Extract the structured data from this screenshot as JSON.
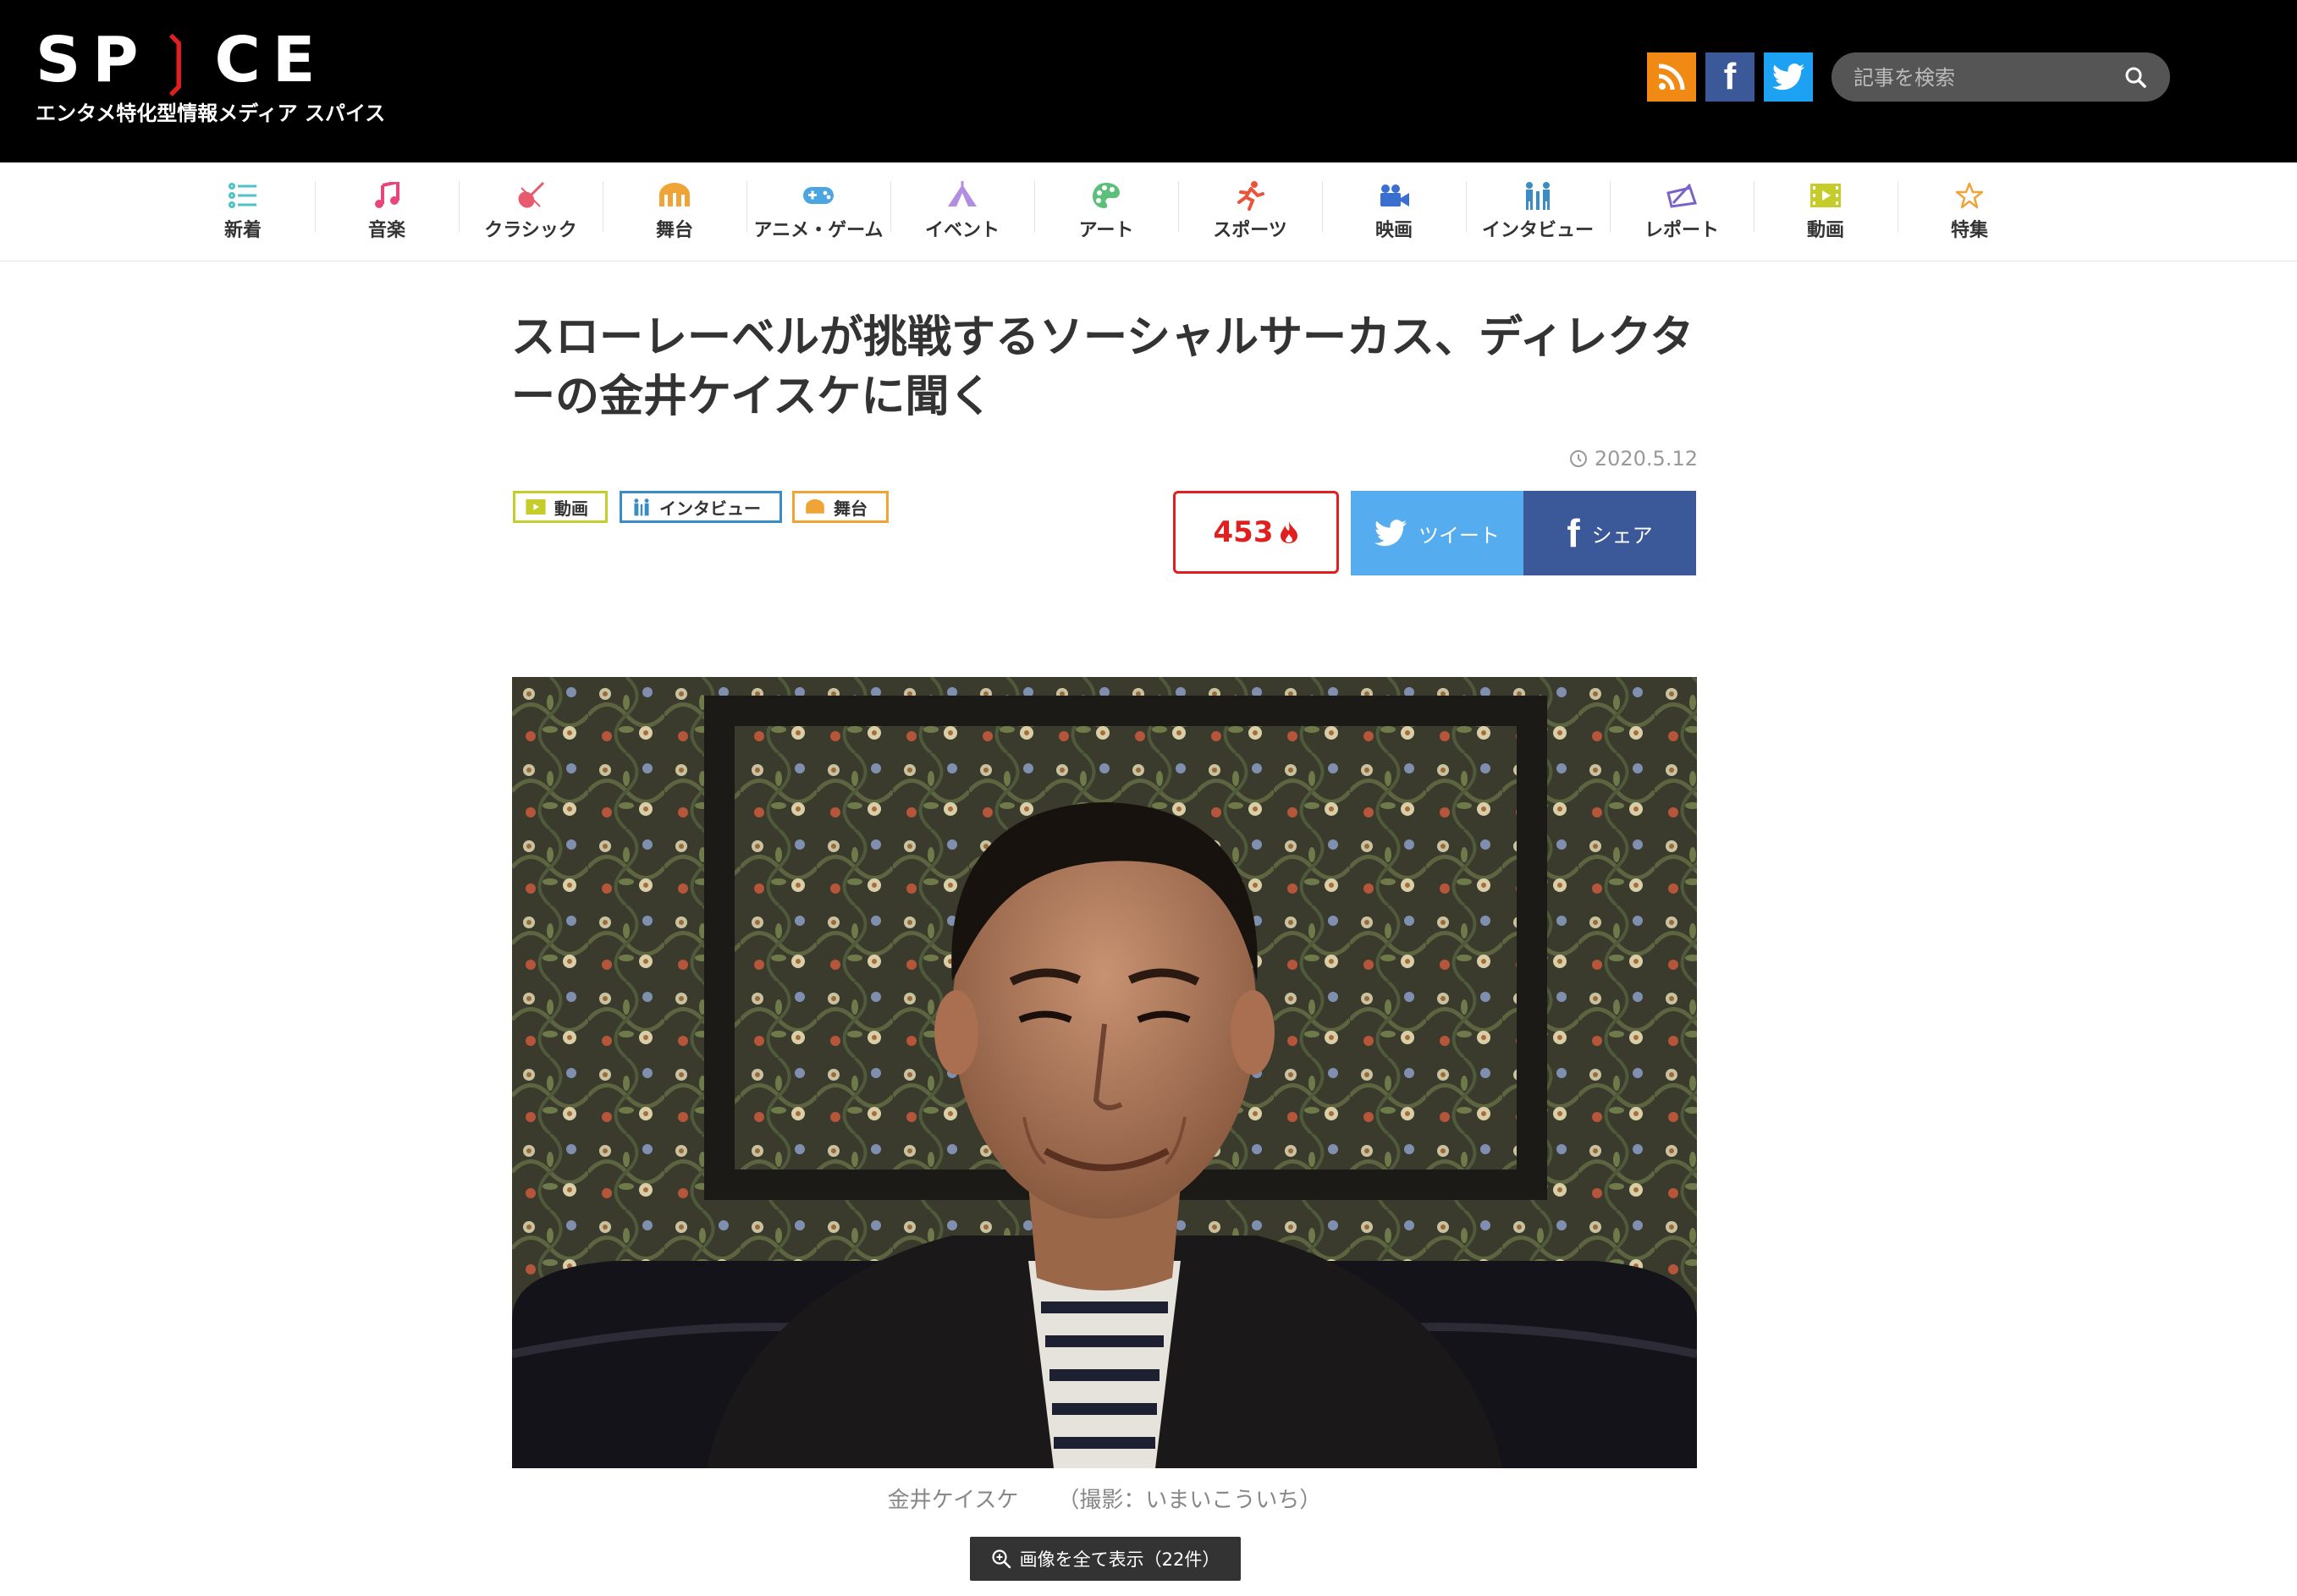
{
  "header": {
    "logo_text": "SPICE",
    "tagline": "エンタメ特化型情報メディア スパイス",
    "search_placeholder": "記事を検索"
  },
  "nav": [
    {
      "label": "新着",
      "icon": "list-icon",
      "color": "#4fc1c9"
    },
    {
      "label": "音楽",
      "icon": "music-note-icon",
      "color": "#e8457a"
    },
    {
      "label": "クラシック",
      "icon": "violin-icon",
      "color": "#e85a6e"
    },
    {
      "label": "舞台",
      "icon": "stage-icon",
      "color": "#f0a438"
    },
    {
      "label": "アニメ・ゲーム",
      "icon": "gamepad-icon",
      "color": "#4aa5e0"
    },
    {
      "label": "イベント",
      "icon": "tent-icon",
      "color": "#b28de0"
    },
    {
      "label": "アート",
      "icon": "palette-icon",
      "color": "#5cbf7a"
    },
    {
      "label": "スポーツ",
      "icon": "runner-icon",
      "color": "#e8543c"
    },
    {
      "label": "映画",
      "icon": "video-camera-icon",
      "color": "#3a6fcf"
    },
    {
      "label": "インタビュー",
      "icon": "interview-icon",
      "color": "#3a8cc4"
    },
    {
      "label": "レポート",
      "icon": "report-icon",
      "color": "#7a62c8"
    },
    {
      "label": "動画",
      "icon": "film-icon",
      "color": "#c6cc2a"
    },
    {
      "label": "特集",
      "icon": "star-icon",
      "color": "#f0a438"
    }
  ],
  "article": {
    "title": "スローレーベルが挑戦するソーシャルサーカス、ディレクターの金井ケイスケに聞く",
    "date": "2020.5.12",
    "tags": [
      {
        "label": "動画",
        "color": "#c6cc2a"
      },
      {
        "label": "インタビュー",
        "color": "#3a8cc4"
      },
      {
        "label": "舞台",
        "color": "#f0a438"
      }
    ],
    "likes": "453",
    "tweet_label": "ツイート",
    "share_label": "シェア",
    "caption_name": "金井ケイスケ",
    "caption_credit": "（撮影：いまいこういち）",
    "view_all_label": "画像を全て表示（22件）"
  }
}
